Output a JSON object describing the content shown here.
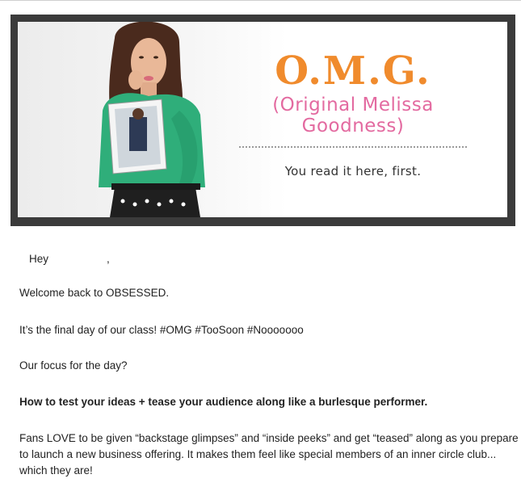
{
  "banner": {
    "title": "O.M.G.",
    "subtitle": "(Original Melissa Goodness)",
    "tagline": "You read it here, first."
  },
  "email": {
    "greeting_word": "Hey",
    "greeting_comma": ",",
    "line1": "Welcome back to OBSESSED.",
    "line2": "It’s the final day of our class! #OMG #TooSoon #Nooooooo",
    "line3": "Our focus for the day?",
    "line4": "How to test your ideas + tease your audience along like a burlesque performer.",
    "line5": "Fans LOVE to be given “backstage glimpses” and “inside peeks” and get “teased” along as you prepare to launch a new business offering. It makes them feel like special members of an inner circle club... which they are!"
  },
  "colors": {
    "title": "#f08b2d",
    "subtitle": "#e36aa0",
    "frame": "#3b3b3b"
  }
}
